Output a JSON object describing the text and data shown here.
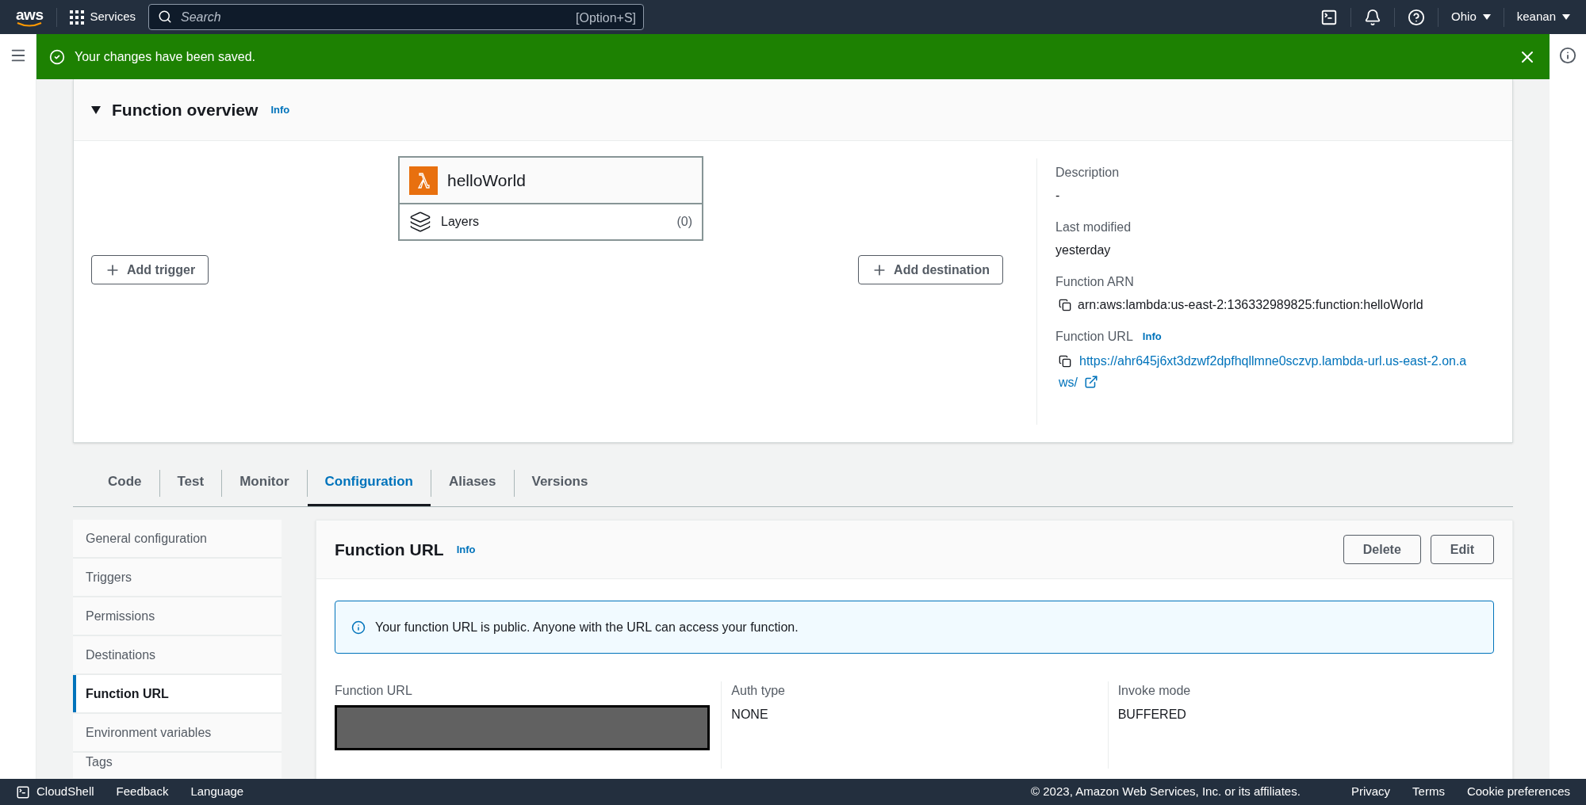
{
  "top_nav": {
    "logo_text": "aws",
    "services_label": "Services",
    "search": {
      "placeholder": "Search",
      "shortcut": "[Option+S]"
    },
    "region": "Ohio",
    "user": "keanan"
  },
  "flash": {
    "kind": "success",
    "message": "Your changes have been saved."
  },
  "overview": {
    "title": "Function overview",
    "info": "Info",
    "expanded": true,
    "function_name": "helloWorld",
    "layers_label": "Layers",
    "layers_count": "(0)",
    "add_trigger": "Add trigger",
    "add_destination": "Add destination",
    "details": [
      {
        "kind": "text",
        "label": "Description",
        "value": "-"
      },
      {
        "kind": "text",
        "label": "Last modified",
        "value": "yesterday"
      },
      {
        "kind": "copy",
        "label": "Function ARN",
        "value": "arn:aws:lambda:us-east-2:136332989825:function:helloWorld"
      },
      {
        "kind": "link",
        "label": "Function URL",
        "info": "Info",
        "value": "https://ahr645j6xt3dzwf2dpfhqllmne0sczvp.lambda-url.us-east-2.on.aws/"
      }
    ]
  },
  "tabs": [
    {
      "label": "Code",
      "selected": false
    },
    {
      "label": "Test",
      "selected": false
    },
    {
      "label": "Monitor",
      "selected": false
    },
    {
      "label": "Configuration",
      "selected": true
    },
    {
      "label": "Aliases",
      "selected": false
    },
    {
      "label": "Versions",
      "selected": false
    }
  ],
  "side_nav": [
    {
      "label": "General configuration",
      "selected": false
    },
    {
      "label": "Triggers",
      "selected": false
    },
    {
      "label": "Permissions",
      "selected": false
    },
    {
      "label": "Destinations",
      "selected": false
    },
    {
      "label": "Function URL",
      "selected": true
    },
    {
      "label": "Environment variables",
      "selected": false
    },
    {
      "label": "Tags",
      "selected": false
    }
  ],
  "function_url_panel": {
    "title": "Function URL",
    "info": "Info",
    "buttons": [
      "Delete",
      "Edit"
    ],
    "alert": {
      "kind": "info",
      "message": "Your function URL is public. Anyone with the URL can access your function."
    },
    "fields": [
      {
        "kind": "redacted",
        "label": "Function URL"
      },
      {
        "kind": "text",
        "label": "Auth type",
        "value": "NONE"
      },
      {
        "kind": "text",
        "label": "Invoke mode",
        "value": "BUFFERED"
      }
    ]
  },
  "footer": {
    "cloudshell": "CloudShell",
    "links_left": [
      "Feedback",
      "Language"
    ],
    "copyright": "© 2023, Amazon Web Services, Inc. or its affiliates.",
    "links_right": [
      "Privacy",
      "Terms",
      "Cookie preferences"
    ]
  }
}
